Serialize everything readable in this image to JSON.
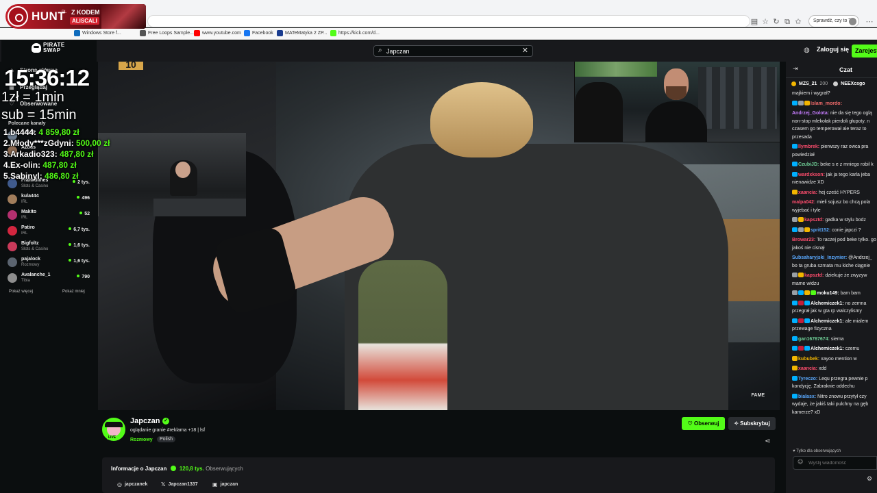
{
  "browser": {
    "profile_label": "Sprawdź, czy to Ty",
    "bookmarks": [
      {
        "label": "Windows Store f...",
        "color": "#0f6cbd"
      },
      {
        "label": "Free Loops Sample...",
        "color": "#555555"
      },
      {
        "label": "www.youtube.com",
        "color": "#ff0000"
      },
      {
        "label": "Facebook",
        "color": "#1877f2"
      },
      {
        "label": "MATeMatyka 2 ZP...",
        "color": "#1a3c8f"
      },
      {
        "label": "https://kick.com/d...",
        "color": "#53fc18"
      }
    ]
  },
  "hunt_banner": {
    "brand": "HUNT",
    "small": "PL",
    "promo_label": "Z KODEM",
    "promo_code": "ALISCALI"
  },
  "topbar": {
    "search_value": "Japczan",
    "login_label": "Zaloguj się",
    "register_label": "Zarejestruj"
  },
  "sidebar": {
    "logo_text": [
      "PIRATE",
      "SWAP"
    ],
    "nav": [
      {
        "label": "Strona główna",
        "icon": "home-icon"
      },
      {
        "label": "Przeglądaj",
        "icon": "compass-icon"
      }
    ],
    "following_label": "Obserwowane",
    "recommended_label": "Polecane kanały",
    "channels": [
      {
        "name": "b4444",
        "category": "",
        "viewers": "",
        "color": "#6b7c8f"
      },
      {
        "name": "Azdus",
        "category": "",
        "viewers": "",
        "color": "#8c6b52"
      },
      {
        "name": "Frankdimes",
        "category": "Slots & Casino",
        "viewers": "2 tys.",
        "color": "#3f5a8c"
      },
      {
        "name": "kula444",
        "category": "IRL",
        "viewers": "496",
        "color": "#a17d5b"
      },
      {
        "name": "Makito",
        "category": "IRL",
        "viewers": "52",
        "color": "#b4306f"
      },
      {
        "name": "Patiro",
        "category": "IRL",
        "viewers": "6,7 tys.",
        "color": "#d3263f"
      },
      {
        "name": "Bigfoltz",
        "category": "Slots & Casino",
        "viewers": "1,6 tys.",
        "color": "#c93a5a"
      },
      {
        "name": "pajalock",
        "category": "Rozmowy",
        "viewers": "1,6 tys.",
        "color": "#5b6470"
      },
      {
        "name": "Avalanche_1",
        "category": "Tibia",
        "viewers": "790",
        "color": "#8e8e8e"
      }
    ],
    "show_more": "Pokaż więcej",
    "show_less": "Pokaż mniej"
  },
  "overlay": {
    "clock": "15:36:12",
    "line1": "1zł = 1min",
    "line2": "sub = 15min",
    "ranking": [
      {
        "rank": "1.",
        "name": "b4444:",
        "amount": "4 859,80 zł"
      },
      {
        "rank": "2.",
        "name": "Młody***zGdyni:",
        "amount": "500,00 zł"
      },
      {
        "rank": "3.",
        "name": "Arkadio323:",
        "amount": "487,80 zł"
      },
      {
        "rank": "4.",
        "name": "Ex-olin:",
        "amount": "487,80 zł"
      },
      {
        "rank": "5.",
        "name": "Sabinyl:",
        "amount": "486,80 zł"
      }
    ]
  },
  "player": {
    "badge": "10",
    "watermark": "FAME"
  },
  "stream": {
    "name": "Japczan",
    "live": "LIVE",
    "title": "oglądanie granie #reklama +18 | lsf",
    "category": "Rozmowy",
    "tag": "Polish",
    "follow_label": "Obserwuj",
    "subscribe_label": "Subskrybuj",
    "about_prefix": "Informacje o Japczan",
    "followers_count": "120,8 tys.",
    "followers_label": "Obserwujących",
    "socials": [
      {
        "icon": "instagram-icon",
        "glyph": "◎",
        "label": "japczanek"
      },
      {
        "icon": "x-icon",
        "glyph": "𝕏",
        "label": "Japczan1337"
      },
      {
        "icon": "kick-icon",
        "glyph": "▣",
        "label": "japczan"
      }
    ]
  },
  "chat": {
    "title": "Czat",
    "gifters": [
      {
        "name": "MZS_21",
        "count": "200"
      },
      {
        "name": "NEEXcsgo",
        "count": ""
      }
    ],
    "messages": [
      {
        "user": "",
        "color": "#ffffff",
        "text": "majkiem i wygrał?",
        "badges": []
      },
      {
        "user": "Islam_mordo:",
        "color": "#f26b6b",
        "text": "",
        "badges": [
          "#00b0ff",
          "#9aa0a6",
          "#f3b600"
        ]
      },
      {
        "user": "Andrzej_Golota:",
        "color": "#c77dff",
        "text": "nie da się tego oglą non-stop mlekołak pierdoli głupoty. n czasem go temperował ale teraz to przesada",
        "badges": []
      },
      {
        "user": "llymbrek:",
        "color": "#ff4d6d",
        "text": "pierwszy raz owca pra powiedział",
        "badges": [
          "#00b0ff"
        ]
      },
      {
        "user": "CzubiJD:",
        "color": "#6fcf97",
        "text": "beke s e z mniego robił k",
        "badges": [
          "#00b0ff"
        ]
      },
      {
        "user": "wardxkson:",
        "color": "#ff4d6d",
        "text": "jak ja tego karla jeba nienawidze XD",
        "badges": [
          "#00b0ff"
        ]
      },
      {
        "user": "xaancia:",
        "color": "#ff4d6d",
        "text": "hej cześć HYPERS",
        "badges": [
          "#f3b600"
        ]
      },
      {
        "user": "malpa042:",
        "color": "#ff4d6d",
        "text": "mieli sojusz bo chcą pola wyjebać i tyle",
        "badges": []
      },
      {
        "user": "kapsztd:",
        "color": "#ff4d6d",
        "text": "gadka w stylu bodz",
        "badges": [
          "#9aa0a6",
          "#f3b600"
        ]
      },
      {
        "user": "sprit152:",
        "color": "#5aa9ff",
        "text": "conie japczi ?",
        "badges": [
          "#00b0ff",
          "#9aa0a6",
          "#f3b600"
        ]
      },
      {
        "user": "Browar23:",
        "color": "#ff4d6d",
        "text": "To raczej pod beke tylko. go jakoś nie cisnął",
        "badges": []
      },
      {
        "user": "Subsaharyjski_Inzynier:",
        "color": "#5aa9ff",
        "text": "@Andrzej_ bo ta gruba szmata mu kiche ciągnie",
        "badges": []
      },
      {
        "user": "kapsztd:",
        "color": "#ff4d6d",
        "text": "dziekuje że zwyzyw mame widzu",
        "badges": [
          "#9aa0a6",
          "#f3b600"
        ]
      },
      {
        "user": "moku149:",
        "color": "#ffffff",
        "text": "bam bam",
        "badges": [
          "#9aa0a6",
          "#00b0ff",
          "#f3b600",
          "#53fc18"
        ]
      },
      {
        "user": "Alchemiczek1:",
        "color": "#ffffff",
        "text": "no zemna przegrał jak w gta rp walczylismy",
        "badges": [
          "#00b0ff",
          "#c41e3a",
          "#00b0ff"
        ]
      },
      {
        "user": "Alchemiczek1:",
        "color": "#ffffff",
        "text": "ale mialem przewage fizyczna",
        "badges": [
          "#00b0ff",
          "#c41e3a",
          "#00b0ff"
        ]
      },
      {
        "user": "gan16767674:",
        "color": "#6fcf97",
        "text": "siema",
        "badges": [
          "#00b0ff"
        ]
      },
      {
        "user": "Alchemiczek1:",
        "color": "#ffffff",
        "text": "czemu",
        "badges": [
          "#00b0ff",
          "#c41e3a",
          "#00b0ff"
        ]
      },
      {
        "user": "kububek:",
        "color": "#f3b600",
        "text": "xayoo mention w",
        "badges": [
          "#f3b600"
        ]
      },
      {
        "user": "xaancia:",
        "color": "#ff4d6d",
        "text": "xdd",
        "badges": [
          "#f3b600"
        ]
      },
      {
        "user": "Tyreczo:",
        "color": "#5aa9ff",
        "text": "Lequ przegra pewnie p kondycję. Zabraknie oddechu",
        "badges": [
          "#00b0ff"
        ]
      },
      {
        "user": "bialasx:",
        "color": "#5aa9ff",
        "text": "Nitro znowu przytył czy wydaje, że jakiś taki pulchny na gęb kamerze? xD",
        "badges": [
          "#00b0ff"
        ]
      }
    ],
    "followers_only": "Tylko dla obserwujących",
    "input_placeholder": "Wyślij wiadomość"
  }
}
